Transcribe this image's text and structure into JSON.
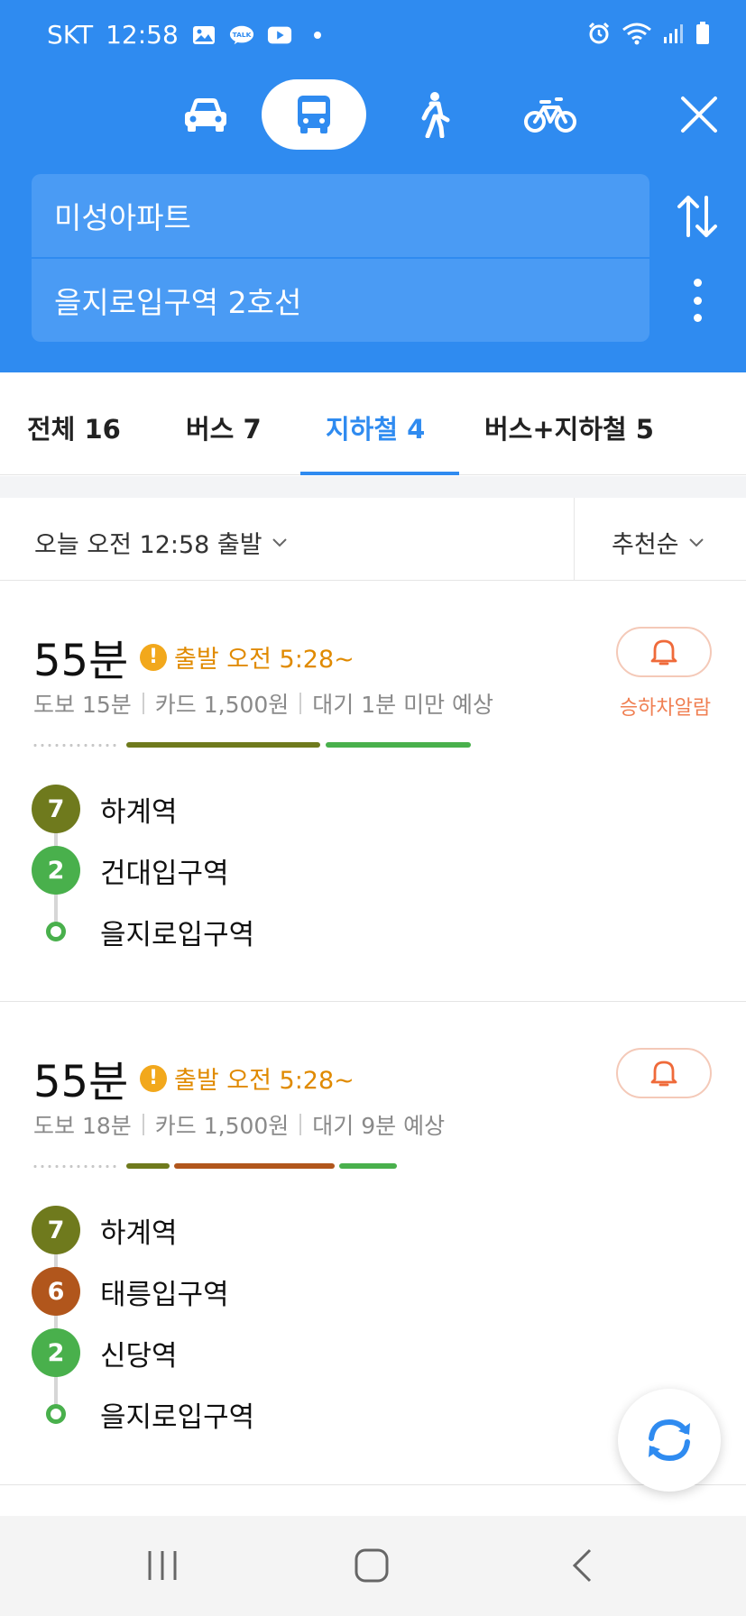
{
  "status_bar": {
    "carrier": "SKT",
    "time": "12:58",
    "icons": [
      "gallery-icon",
      "talk-icon",
      "youtube-icon",
      "dot-icon",
      "alarm-icon",
      "wifi-icon",
      "signal-icon",
      "battery-icon"
    ],
    "talk_badge": "TALK"
  },
  "transport_modes": [
    {
      "name": "car",
      "icon": "car-icon"
    },
    {
      "name": "bus",
      "icon": "bus-icon",
      "selected": true
    },
    {
      "name": "walk",
      "icon": "walk-icon"
    },
    {
      "name": "bike",
      "icon": "bike-icon"
    }
  ],
  "route": {
    "origin": "미성아파트",
    "destination": "을지로입구역 2호선"
  },
  "tabs": [
    {
      "label": "전체 16"
    },
    {
      "label": "버스 7"
    },
    {
      "label": "지하철 4",
      "active": true
    },
    {
      "label": "버스+지하철 5"
    }
  ],
  "filter": {
    "departure": "오늘 오전 12:58 출발",
    "sort": "추천순"
  },
  "results": [
    {
      "duration": "55분",
      "warning": "출발 오전 5:28~",
      "walk": "도보 15분",
      "fare": "카드 1,500원",
      "wait": "대기 1분 미만 예상",
      "alarm_label": "승하차알람",
      "stops": [
        {
          "line": "7",
          "name": "하계역",
          "color": "#6f7a1d"
        },
        {
          "line": "2",
          "name": "건대입구역",
          "color": "#49b04c"
        },
        {
          "line": "",
          "name": "을지로입구역",
          "color": "#49b04c"
        }
      ]
    },
    {
      "duration": "55분",
      "warning": "출발 오전 5:28~",
      "walk": "도보 18분",
      "fare": "카드 1,500원",
      "wait": "대기 9분 예상",
      "stops": [
        {
          "line": "7",
          "name": "하계역",
          "color": "#6f7a1d"
        },
        {
          "line": "6",
          "name": "태릉입구역",
          "color": "#b1561c"
        },
        {
          "line": "2",
          "name": "신당역",
          "color": "#49b04c"
        },
        {
          "line": "",
          "name": "을지로입구역",
          "color": "#49b04c"
        }
      ]
    }
  ],
  "colors": {
    "header_blue": "#2f8bf0",
    "line7": "#6f7a1d",
    "line6": "#b1561c",
    "line2": "#49b04c",
    "warning": "#e08a00",
    "alarm": "#f07f52"
  }
}
